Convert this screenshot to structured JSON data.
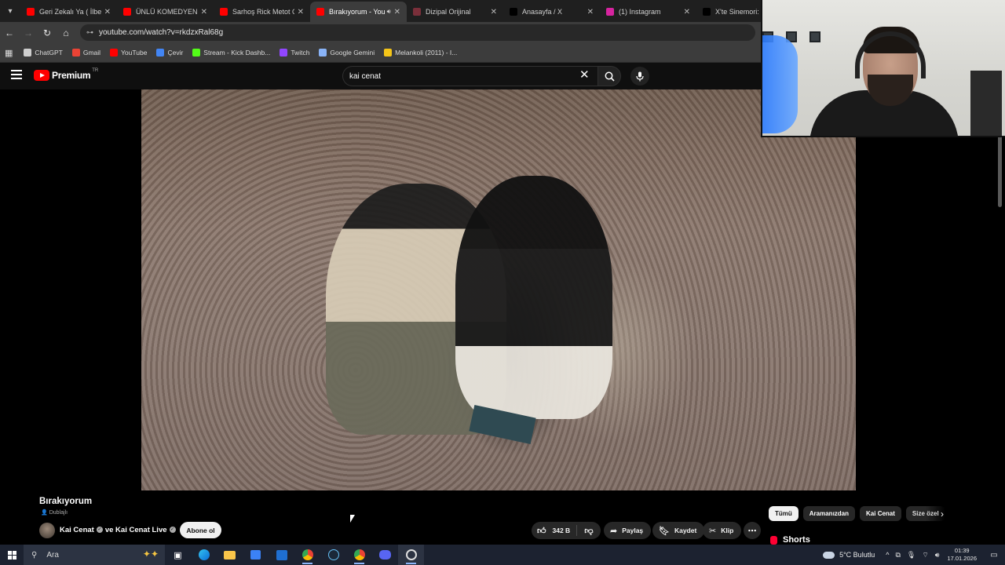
{
  "browser": {
    "tabs": [
      {
        "title": "Geri Zekalı Ya ( İlber Ortaylı",
        "icon": "youtube-icon",
        "color": "#ff0000",
        "active": false
      },
      {
        "title": "ÜNLÜ KOMEDYENLERİ",
        "icon": "youtube-icon",
        "color": "#ff0000",
        "active": false
      },
      {
        "title": "Sarhoş Rick Metot Oyunculuk",
        "icon": "youtube-icon",
        "color": "#ff0000",
        "active": false
      },
      {
        "title": "Bırakıyorum - YouTube",
        "icon": "youtube-icon",
        "color": "#ff0000",
        "active": true
      },
      {
        "title": "Dizipal Orijinal",
        "icon": "dizipal-icon",
        "color": "#7a2f3a",
        "active": false
      },
      {
        "title": "Anasayfa / X",
        "icon": "x-icon",
        "color": "#000000",
        "active": false
      },
      {
        "title": "(1) Instagram",
        "icon": "instagram-icon",
        "color": "#d6249f",
        "active": false
      },
      {
        "title": "X'te Sinemori: \"Kaç",
        "icon": "x-icon",
        "color": "#000000",
        "active": false
      }
    ],
    "url": "youtube.com/watch?v=rkdzxRal68g",
    "bookmarks": [
      {
        "label": "ChatGPT",
        "icon": "chatgpt-icon",
        "color": "#cfcfcf"
      },
      {
        "label": "Gmail",
        "icon": "gmail-icon",
        "color": "#ea4335"
      },
      {
        "label": "YouTube",
        "icon": "youtube-icon",
        "color": "#ff0000"
      },
      {
        "label": "Çevir",
        "icon": "translate-icon",
        "color": "#4285f4"
      },
      {
        "label": "Stream - Kick Dashb...",
        "icon": "kick-icon",
        "color": "#53fc18"
      },
      {
        "label": "Twitch",
        "icon": "twitch-icon",
        "color": "#9146ff"
      },
      {
        "label": "Google Gemini",
        "icon": "gemini-icon",
        "color": "#8ab4f8"
      },
      {
        "label": "Melankoli (2011) - I...",
        "icon": "imdb-icon",
        "color": "#f5c518"
      }
    ]
  },
  "youtube": {
    "logo_text": "Premium",
    "logo_country": "TR",
    "search_query": "kai cenat",
    "video_title": "Bırakıyorum",
    "dubbed_label": "Dublajlı",
    "channel_text": "Kai Cenat",
    "channel_join": "ve",
    "channel_text2": "Kai Cenat Live",
    "subscribe_label": "Abone ol",
    "like_count": "342 B",
    "share_label": "Paylaş",
    "save_label": "Kaydet",
    "clip_label": "Klip",
    "chips": [
      "Tümü",
      "Aramanızdan",
      "Kai Cenat",
      "Size özel"
    ],
    "shorts_label": "Shorts"
  },
  "taskbar": {
    "search_placeholder": "Ara",
    "weather": "5°C  Bulutlu",
    "time": "01:39",
    "date": "17.01.2026"
  }
}
